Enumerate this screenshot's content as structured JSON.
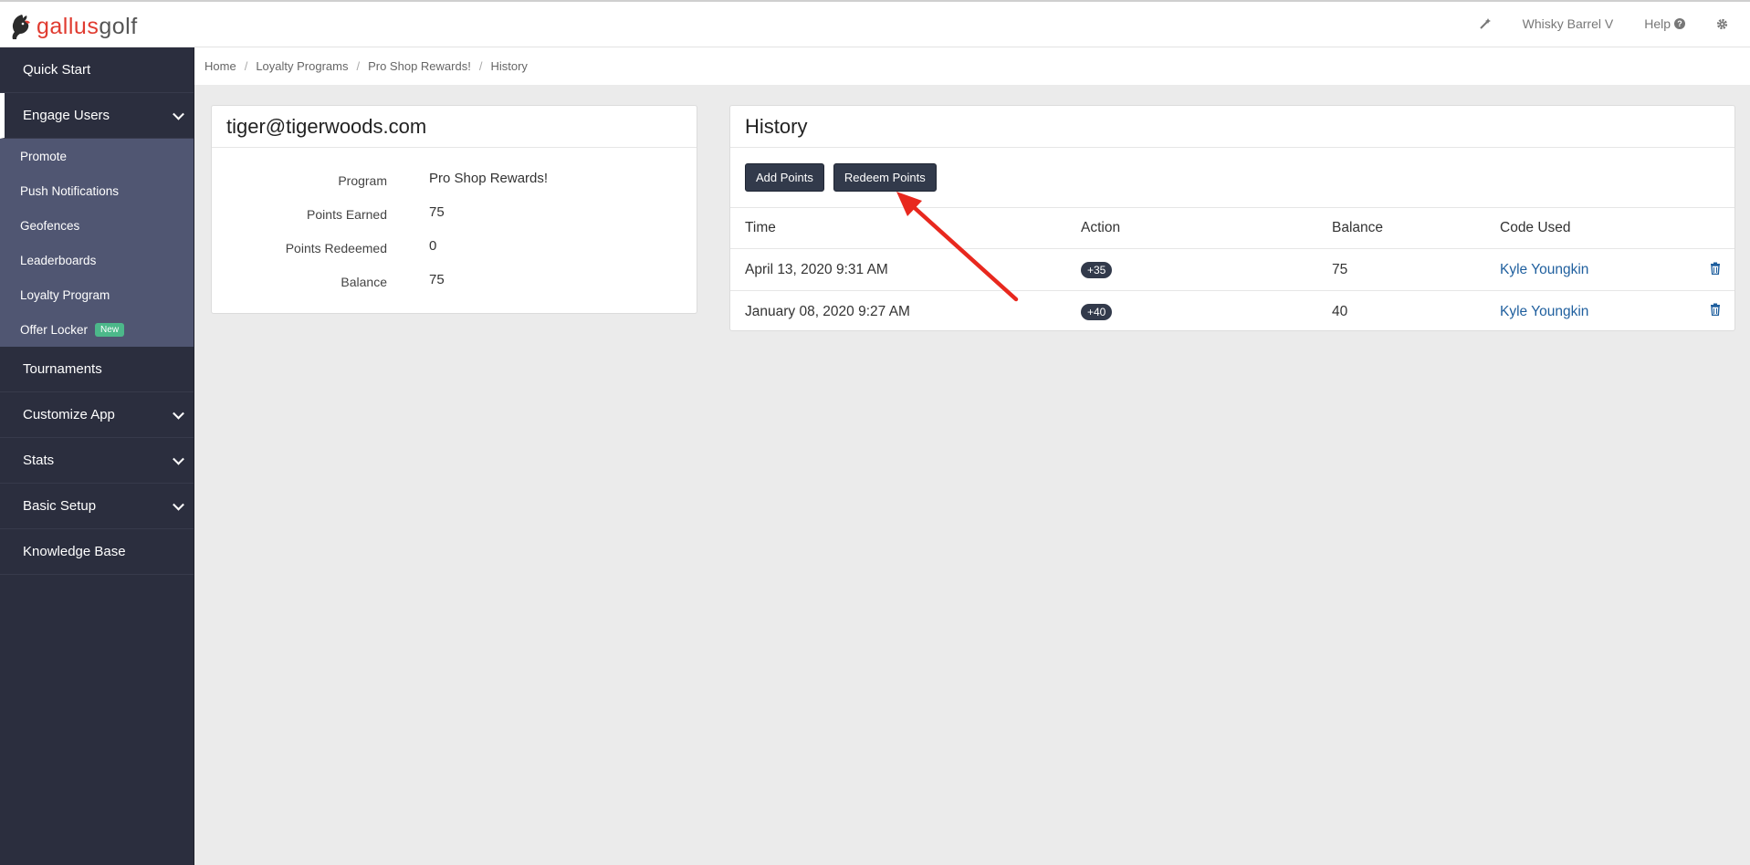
{
  "brand": {
    "part1": "gallus",
    "part2": "golf"
  },
  "topbar": {
    "wand_icon": "magic-wand-icon",
    "course": "Whisky Barrel V",
    "help": "Help",
    "help_icon": "question-circle-icon",
    "settings_icon": "gear-icon"
  },
  "sidebar": {
    "quick_start": "Quick Start",
    "engage_users": "Engage Users",
    "engage_items": [
      "Promote",
      "Push Notifications",
      "Geofences",
      "Leaderboards",
      "Loyalty Program",
      "Offer Locker"
    ],
    "new_badge": "New",
    "tournaments": "Tournaments",
    "customize_app": "Customize App",
    "stats": "Stats",
    "basic_setup": "Basic Setup",
    "knowledge_base": "Knowledge Base"
  },
  "breadcrumb": [
    "Home",
    "Loyalty Programs",
    "Pro Shop Rewards!",
    "History"
  ],
  "user_panel": {
    "email": "tiger@tigerwoods.com",
    "rows": [
      {
        "label": "Program",
        "value": "Pro Shop Rewards!"
      },
      {
        "label": "Points Earned",
        "value": "75"
      },
      {
        "label": "Points Redeemed",
        "value": "0"
      },
      {
        "label": "Balance",
        "value": "75"
      }
    ]
  },
  "history": {
    "title": "History",
    "add_points": "Add Points",
    "redeem_points": "Redeem Points",
    "columns": [
      "Time",
      "Action",
      "Balance",
      "Code Used"
    ],
    "rows": [
      {
        "time": "April 13, 2020 9:31 AM",
        "action": "+35",
        "balance": "75",
        "code": "Kyle Youngkin"
      },
      {
        "time": "January 08, 2020 9:27 AM",
        "action": "+40",
        "balance": "40",
        "code": "Kyle Youngkin"
      }
    ]
  },
  "annotation_color": "#e8281e"
}
